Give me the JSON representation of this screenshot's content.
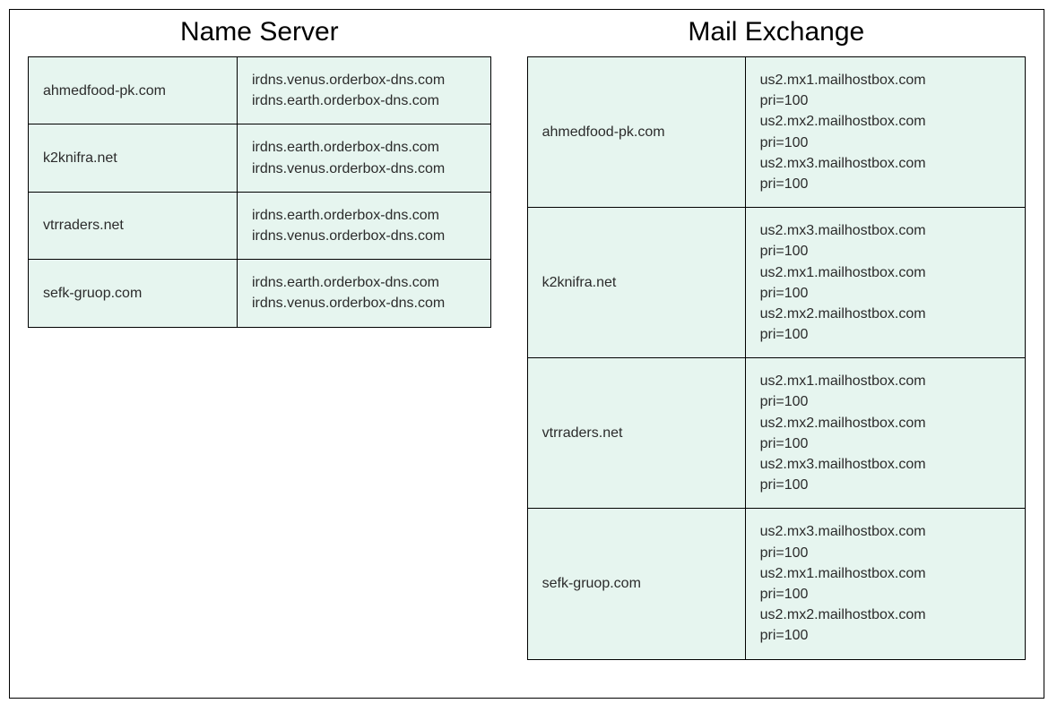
{
  "titles": {
    "name_server": "Name Server",
    "mail_exchange": "Mail Exchange"
  },
  "name_server": [
    {
      "domain": "ahmedfood-pk.com",
      "servers": [
        "irdns.venus.orderbox-dns.com",
        "irdns.earth.orderbox-dns.com"
      ]
    },
    {
      "domain": "k2knifra.net",
      "servers": [
        "irdns.earth.orderbox-dns.com",
        "irdns.venus.orderbox-dns.com"
      ]
    },
    {
      "domain": "vtrraders.net",
      "servers": [
        "irdns.earth.orderbox-dns.com",
        "irdns.venus.orderbox-dns.com"
      ]
    },
    {
      "domain": "sefk-gruop.com",
      "servers": [
        "irdns.earth.orderbox-dns.com",
        "irdns.venus.orderbox-dns.com"
      ]
    }
  ],
  "mail_exchange": [
    {
      "domain": "ahmedfood-pk.com",
      "records": [
        {
          "host": "us2.mx1.mailhostbox.com",
          "pri": 100
        },
        {
          "host": "us2.mx2.mailhostbox.com",
          "pri": 100
        },
        {
          "host": "us2.mx3.mailhostbox.com",
          "pri": 100
        }
      ]
    },
    {
      "domain": "k2knifra.net",
      "records": [
        {
          "host": "us2.mx3.mailhostbox.com",
          "pri": 100
        },
        {
          "host": "us2.mx1.mailhostbox.com",
          "pri": 100
        },
        {
          "host": "us2.mx2.mailhostbox.com",
          "pri": 100
        }
      ]
    },
    {
      "domain": "vtrraders.net",
      "records": [
        {
          "host": "us2.mx1.mailhostbox.com",
          "pri": 100
        },
        {
          "host": "us2.mx2.mailhostbox.com",
          "pri": 100
        },
        {
          "host": "us2.mx3.mailhostbox.com",
          "pri": 100
        }
      ]
    },
    {
      "domain": "sefk-gruop.com",
      "records": [
        {
          "host": "us2.mx3.mailhostbox.com",
          "pri": 100
        },
        {
          "host": "us2.mx1.mailhostbox.com",
          "pri": 100
        },
        {
          "host": "us2.mx2.mailhostbox.com",
          "pri": 100
        }
      ]
    }
  ]
}
